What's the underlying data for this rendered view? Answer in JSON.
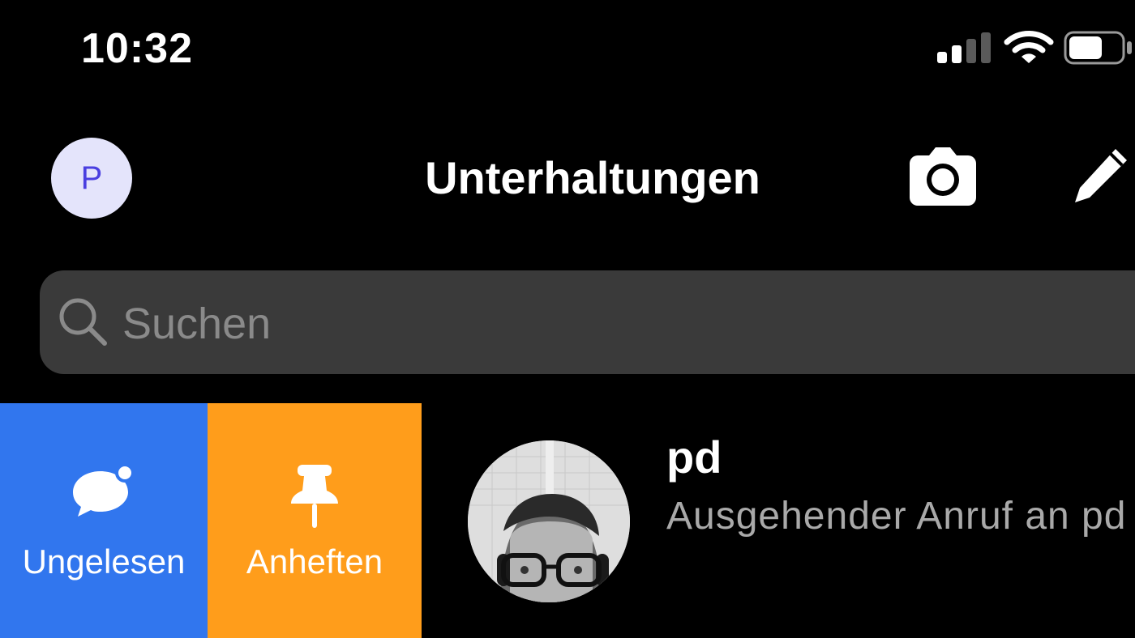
{
  "status_bar": {
    "time": "10:32",
    "icons": [
      "signal-icon",
      "wifi-icon",
      "battery-icon"
    ],
    "signal_bars": 2,
    "battery_level": 0.65
  },
  "header": {
    "avatar_initial": "P",
    "title": "Unterhaltungen",
    "icons": [
      "camera-icon",
      "compose-icon"
    ]
  },
  "search": {
    "placeholder": "Suchen",
    "icon": "search-icon"
  },
  "conversation": {
    "actions": [
      {
        "label": "Ungelesen",
        "icon": "unread-chat-icon",
        "color": "#3176ee"
      },
      {
        "label": "Anheften",
        "icon": "pin-icon",
        "color": "#ff9d1b"
      }
    ],
    "name": "pd",
    "preview": "Ausgehender Anruf an pd"
  },
  "colors": {
    "background": "#000000",
    "search_bg": "#3a3a3a",
    "avatar_bg": "#e4e4fb",
    "avatar_text": "#4a3fe0"
  }
}
